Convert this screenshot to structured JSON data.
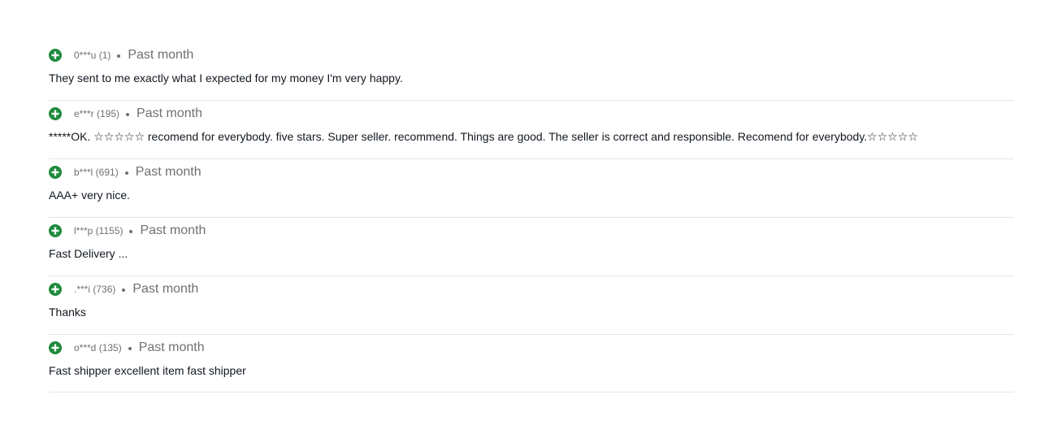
{
  "colors": {
    "positive": "#1e8a3c",
    "meta_text": "#707070",
    "comment_text": "#111820",
    "divider": "#e5e5e5"
  },
  "feedback": [
    {
      "icon": "positive-plus-icon",
      "user": "0***u (1)",
      "time": "Past month",
      "comment": "They sent to me exactly what I expected for my money I'm very happy."
    },
    {
      "icon": "positive-plus-icon",
      "user": "e***r (195)",
      "time": "Past month",
      "comment": "*****OK. ☆☆☆☆☆ recomend for everybody. five stars. Super seller. recommend. Things are good. The seller is correct and responsible. Recomend for everybody.☆☆☆☆☆"
    },
    {
      "icon": "positive-plus-icon",
      "user": "b***l (691)",
      "time": "Past month",
      "comment": "AAA+ very nice."
    },
    {
      "icon": "positive-plus-icon",
      "user": "l***p (1155)",
      "time": "Past month",
      "comment": "Fast Delivery ..."
    },
    {
      "icon": "positive-plus-icon",
      "user": ".***i (736)",
      "time": "Past month",
      "comment": "Thanks"
    },
    {
      "icon": "positive-plus-icon",
      "user": "o***d (135)",
      "time": "Past month",
      "comment": "Fast shipper excellent item fast shipper"
    }
  ]
}
